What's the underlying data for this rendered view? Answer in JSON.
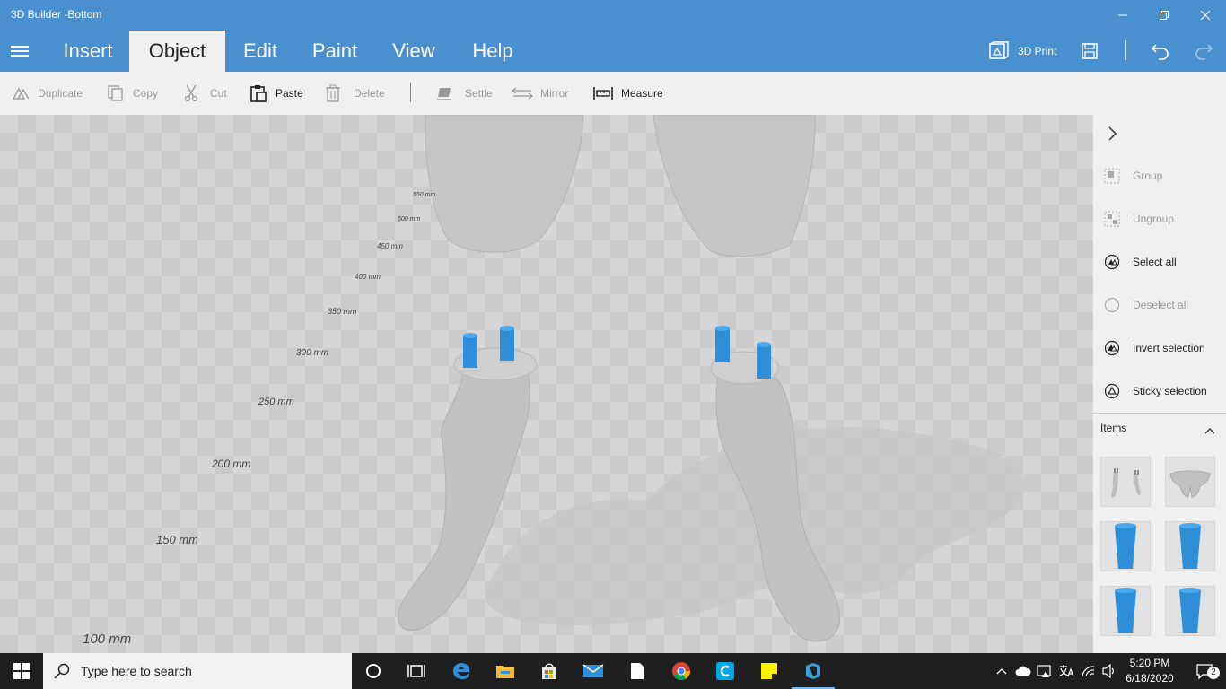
{
  "window": {
    "title": "3D Builder -Bottom"
  },
  "menu": {
    "tabs": [
      {
        "label": "Insert"
      },
      {
        "label": "Object"
      },
      {
        "label": "Edit"
      },
      {
        "label": "Paint"
      },
      {
        "label": "View"
      },
      {
        "label": "Help"
      }
    ],
    "active_tab": "Object",
    "print_label": "3D Print"
  },
  "toolbar": {
    "duplicate": "Duplicate",
    "copy": "Copy",
    "cut": "Cut",
    "paste": "Paste",
    "delete": "Delete",
    "settle": "Settle",
    "mirror": "Mirror",
    "measure": "Measure"
  },
  "ruler": {
    "labels": [
      "550 mm",
      "500 mm",
      "450 mm",
      "400 mm",
      "350 mm",
      "300 mm",
      "250 mm",
      "200 mm",
      "150 mm",
      "100 mm"
    ]
  },
  "sidepanel": {
    "group": "Group",
    "ungroup": "Ungroup",
    "select_all": "Select all",
    "deselect_all": "Deselect all",
    "invert_selection": "Invert selection",
    "sticky_selection": "Sticky selection",
    "items_header": "Items"
  },
  "taskbar": {
    "search_placeholder": "Type here to search",
    "time": "5:20 PM",
    "date": "6/18/2020",
    "notification_count": "2"
  },
  "colors": {
    "accent": "#4a90d0",
    "pin_blue": "#2e8ed8",
    "model_gray": "#c4c4c4"
  }
}
